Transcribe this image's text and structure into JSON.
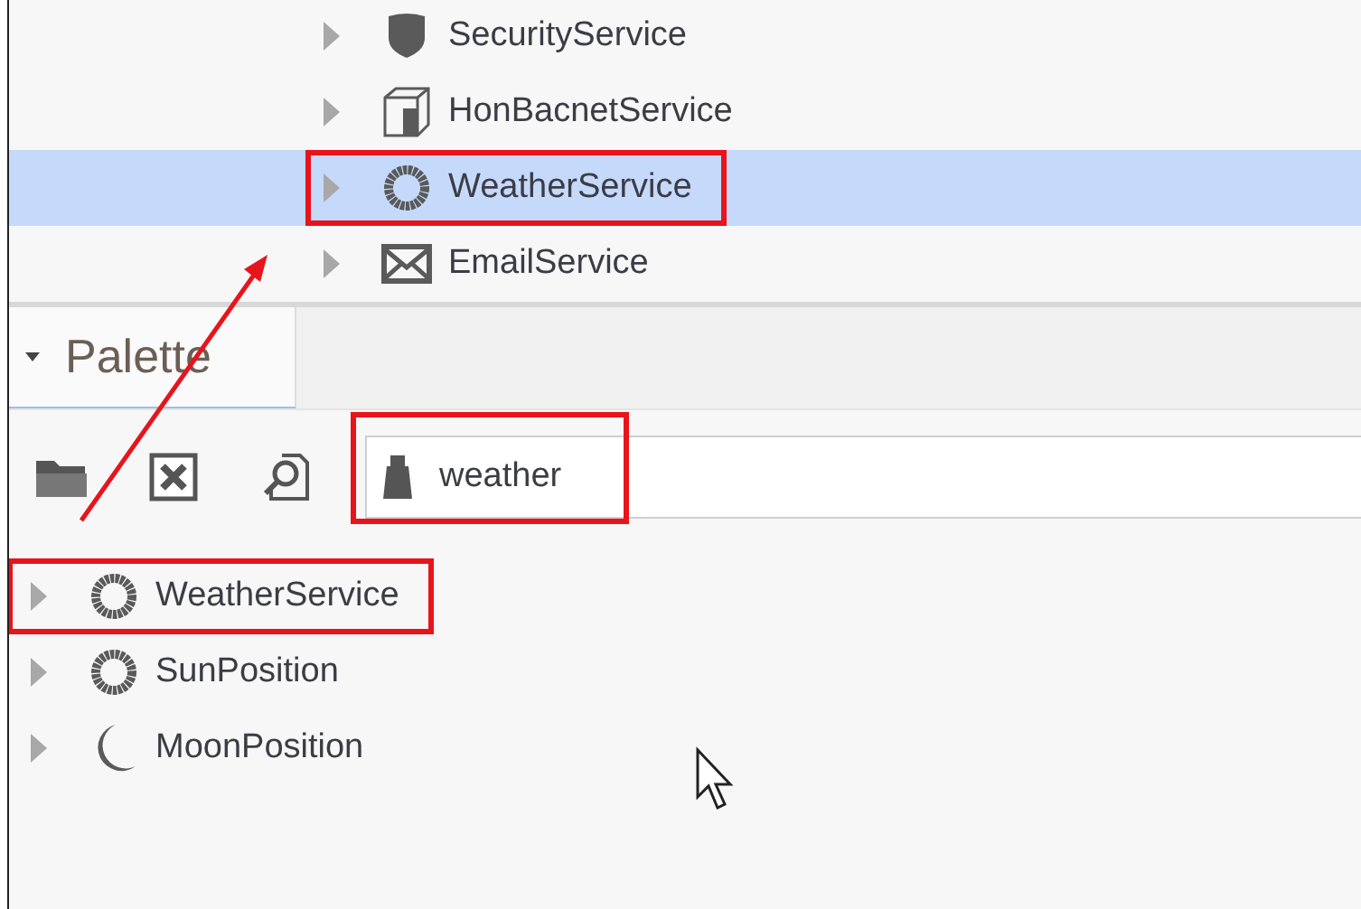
{
  "nav_tree": {
    "items": [
      {
        "label": "SecurityService",
        "kind": "security",
        "selected": false,
        "highlighted": false
      },
      {
        "label": "HonBacnetService",
        "kind": "bacnet",
        "selected": false,
        "highlighted": false
      },
      {
        "label": "WeatherService",
        "kind": "weather",
        "selected": true,
        "highlighted": true
      },
      {
        "label": "EmailService",
        "kind": "email",
        "selected": false,
        "highlighted": false
      }
    ]
  },
  "palette": {
    "title": "Palette",
    "expanded": true,
    "search": {
      "value": "weather",
      "highlighted": true
    },
    "items": [
      {
        "label": "WeatherService",
        "kind": "weather",
        "selected": false,
        "highlighted": true
      },
      {
        "label": "SunPosition",
        "kind": "sun",
        "selected": false,
        "highlighted": false
      },
      {
        "label": "MoonPosition",
        "kind": "moon",
        "selected": false,
        "highlighted": false
      }
    ]
  }
}
